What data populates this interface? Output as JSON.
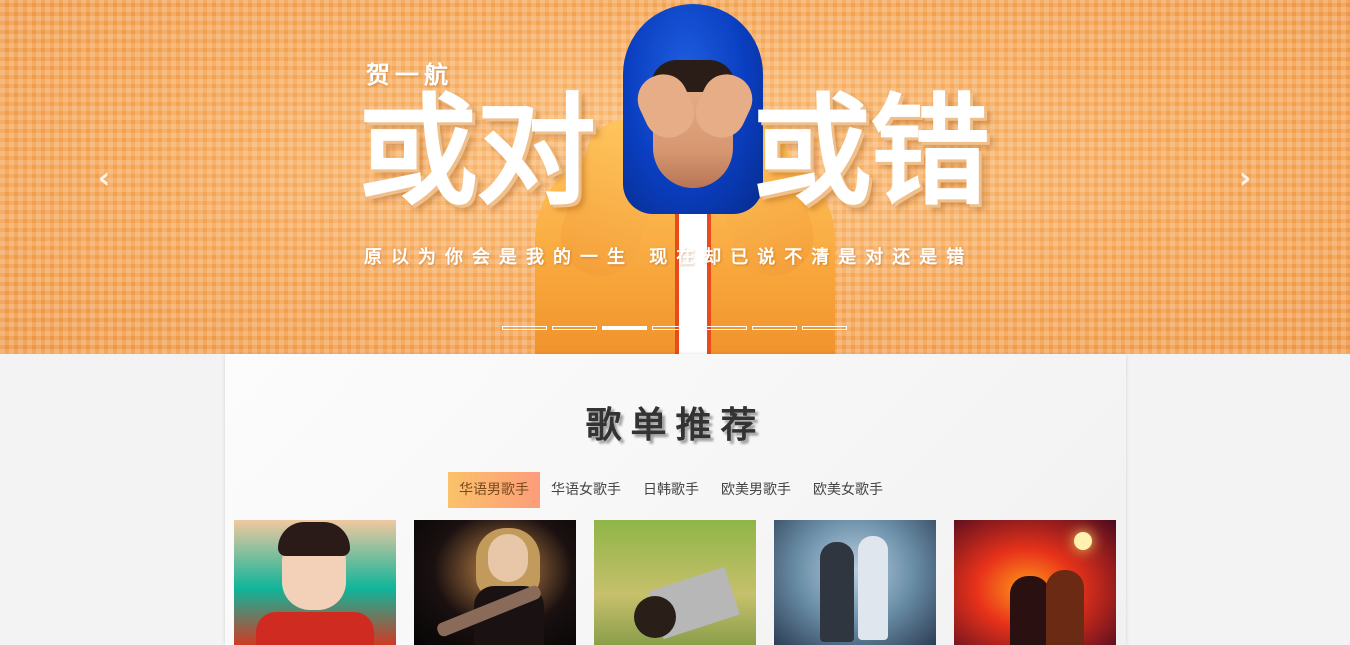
{
  "banner": {
    "artist": "贺一航",
    "title_left": "或对",
    "title_right": "或错",
    "lyric": "原以为你会是我的一生 现在却已说不清是对还是错",
    "prev_icon": "chevron-left-icon",
    "next_icon": "chevron-right-icon",
    "prev_glyph": "‹",
    "next_glyph": "›",
    "slide_count": 7,
    "active_slide": 3
  },
  "section": {
    "title": "歌单推荐",
    "tabs": [
      {
        "label": "华语男歌手",
        "active": true
      },
      {
        "label": "华语女歌手",
        "active": false
      },
      {
        "label": "日韩歌手",
        "active": false
      },
      {
        "label": "欧美男歌手",
        "active": false
      },
      {
        "label": "欧美女歌手",
        "active": false
      }
    ]
  },
  "colors": {
    "banner_bg": "#f4a24f",
    "tab_active_start": "#fbc269",
    "tab_active_end": "#fc9c7a",
    "page_bg": "#f3f3f3"
  }
}
